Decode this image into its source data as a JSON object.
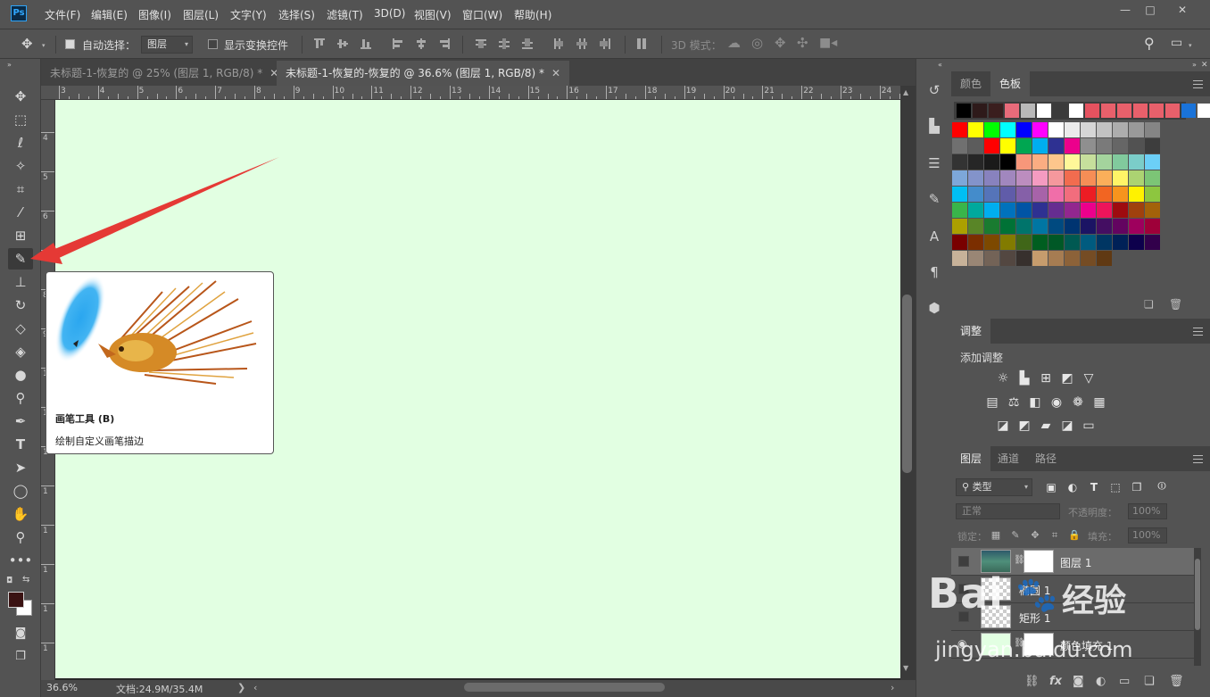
{
  "app": {
    "logo": "Ps"
  },
  "menu": [
    "文件(F)",
    "编辑(E)",
    "图像(I)",
    "图层(L)",
    "文字(Y)",
    "选择(S)",
    "滤镜(T)",
    "3D(D)",
    "视图(V)",
    "窗口(W)",
    "帮助(H)"
  ],
  "window_controls": {
    "minimize": "—",
    "maximize": "□",
    "close": "✕"
  },
  "options": {
    "auto_select_label": "自动选择：",
    "auto_select_checked": true,
    "target_value": "图层",
    "transform_label": "显示变换控件",
    "transform_checked": false,
    "mode3d_label": "3D 模式："
  },
  "tabs": [
    {
      "label": "未标题-1-恢复的 @ 25% (图层 1, RGB/8) *",
      "close": "✕",
      "active": false
    },
    {
      "label": "未标题-1-恢复的-恢复的 @ 36.6% (图层 1, RGB/8) *",
      "close": "✕",
      "active": true
    }
  ],
  "ruler_h": [
    "3",
    "4",
    "5",
    "6",
    "7",
    "8",
    "9",
    "10",
    "11",
    "12",
    "13",
    "14",
    "15",
    "16",
    "17",
    "18",
    "19",
    "20",
    "21",
    "22",
    "23",
    "24"
  ],
  "ruler_v": [
    "4",
    "5",
    "6",
    "7",
    "8",
    "9",
    "1",
    "1",
    "1",
    "1",
    "1",
    "1",
    "1",
    "1",
    "1",
    "1",
    "1",
    "1",
    "2",
    "2"
  ],
  "canvas": {
    "color": "#e2ffe2"
  },
  "tooltip": {
    "title": "画笔工具 (B)",
    "description": "绘制自定义画笔描边"
  },
  "status": {
    "zoom": "36.6%",
    "doc_info": "文档:24.9M/35.4M",
    "arrow": "❯"
  },
  "swatches_panel": {
    "tabs": [
      "颜色",
      "色板"
    ],
    "active_tab": "色板",
    "recent": [
      "#000000",
      "#2e1a1a",
      "#3a1e1e",
      "#e86b7a",
      "#b9b9b9",
      "#ffffff",
      "#3b3b3b",
      "#ffffff",
      "#e5525f",
      "#e8606b",
      "#e8606b",
      "#e8606b",
      "#e8606b",
      "#e8606b",
      "#1a73d9",
      "#ffffff"
    ],
    "rows": [
      [
        "#ff0000",
        "#ffff00",
        "#00ff00",
        "#00ffff",
        "#0000ff",
        "#ff00ff",
        "#ffffff",
        "#ebebeb",
        "#d6d6d6",
        "#c2c2c2",
        "#adadad",
        "#999999",
        "#858585"
      ],
      [
        "#707070",
        "#5c5c5c",
        "#ff0000",
        "#ffff00",
        "#00a651",
        "#00aeef",
        "#2e3192",
        "#ec008c",
        "#8f8f8f",
        "#7a7a7a",
        "#666666",
        "#525252",
        "#3d3d3d"
      ],
      [
        "#333333",
        "#262626",
        "#1a1a1a",
        "#000000",
        "#f7977a",
        "#fbad82",
        "#fdc68c",
        "#fff799",
        "#c6df9c",
        "#a4d49d",
        "#81ca9d",
        "#7bcdc9",
        "#6ccff7"
      ],
      [
        "#7da7d9",
        "#8393ca",
        "#8882be",
        "#a187be",
        "#bc8dbf",
        "#f49bc1",
        "#f5989d",
        "#f26c4f",
        "#f68e56",
        "#fbaf5a",
        "#fff467",
        "#acd372",
        "#7cc576"
      ],
      [
        "#00bff3",
        "#448ccb",
        "#5574b9",
        "#605ca9",
        "#8560a8",
        "#a763a9",
        "#f06ea9",
        "#f26d7d",
        "#ed1c24",
        "#f26522",
        "#f7941d",
        "#fff200",
        "#8dc63f"
      ],
      [
        "#39b54a",
        "#00a99d",
        "#00aeef",
        "#0072bc",
        "#0054a5",
        "#2e3192",
        "#662d91",
        "#92278f",
        "#ec008c",
        "#ed145b",
        "#9e0b0f",
        "#a0410d",
        "#a3620a"
      ],
      [
        "#aba000",
        "#598527",
        "#197b30",
        "#007236",
        "#00746b",
        "#0076a3",
        "#004a80",
        "#003471",
        "#1b1464",
        "#440e62",
        "#630460",
        "#9e005d",
        "#9e0039"
      ],
      [
        "#790000",
        "#7b2e00",
        "#7d4900",
        "#827b00",
        "#406618",
        "#005e20",
        "#005826",
        "#005952",
        "#005b7f",
        "#003663",
        "#002157",
        "#0d004c",
        "#32004b"
      ],
      [
        "#c7b299",
        "#998675",
        "#736357",
        "#534741",
        "#37302d",
        "#c69c6d",
        "#a67c52",
        "#8c6239",
        "#754c24",
        "#603913"
      ]
    ]
  },
  "adjust_panel": {
    "tab": "调整",
    "title": "添加调整"
  },
  "layers_panel": {
    "tabs": [
      "图层",
      "通道",
      "路径"
    ],
    "filter_label": "类型",
    "blend_mode": "正常",
    "opacity_label": "不透明度：",
    "opacity_value": "100%",
    "lock_label": "锁定：",
    "fill_label": "填充：",
    "fill_value": "100%",
    "layers": [
      {
        "name": "图层 1",
        "selected": true
      },
      {
        "name": "椭圆 1",
        "selected": false
      },
      {
        "name": "矩形 1",
        "selected": false
      },
      {
        "name": "颜色填充 1",
        "selected": false
      }
    ]
  },
  "watermark": {
    "brand": "Bai",
    "brand2": "经验",
    "url": "jingyan.baidu.com"
  }
}
